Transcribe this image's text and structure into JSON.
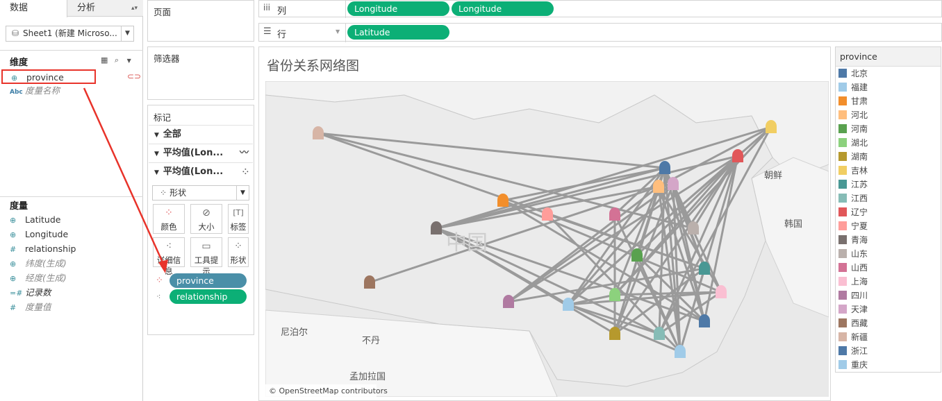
{
  "tabs": {
    "data": "数据",
    "analysis": "分析"
  },
  "datasource": {
    "name": "Sheet1 (新建 Microso..."
  },
  "dimensions": {
    "title": "维度",
    "items": [
      {
        "label": "province",
        "icon": "globe-icon"
      },
      {
        "label": "度量名称",
        "icon": "Abc"
      }
    ]
  },
  "measures": {
    "title": "度量",
    "items": [
      {
        "label": "Latitude",
        "icon": "globe-icon"
      },
      {
        "label": "Longitude",
        "icon": "globe-icon"
      },
      {
        "label": "relationship",
        "icon": "#"
      },
      {
        "label": "纬度(生成)",
        "icon": "globe-icon"
      },
      {
        "label": "经度(生成)",
        "icon": "globe-icon"
      },
      {
        "label": "记录数",
        "icon": "#"
      },
      {
        "label": "度量值",
        "icon": "#"
      }
    ]
  },
  "cards": {
    "pages": "页面",
    "filters": "筛选器",
    "marks": "标记"
  },
  "marks": {
    "all": "全部",
    "avg_lon1": "平均值(Lon...",
    "avg_lon2": "平均值(Lon...",
    "type": "形状",
    "buttons": {
      "color": "颜色",
      "size": "大小",
      "label": "标签",
      "detail": "详细信息",
      "tooltip": "工具提示",
      "shape": "形状"
    },
    "pills": [
      "province",
      "relationship"
    ]
  },
  "shelves": {
    "columns_label": "列",
    "rows_label": "行",
    "columns": [
      "Longitude",
      "Longitude"
    ],
    "rows": [
      "Latitude"
    ]
  },
  "viz": {
    "title": "省份关系网络图",
    "attribution": "© OpenStreetMap contributors",
    "map_labels": {
      "korea_north": "朝鲜",
      "korea_south": "韩国",
      "nepal": "尼泊尔",
      "bhutan": "不丹",
      "bangladesh": "孟加拉国",
      "china": "中国"
    }
  },
  "legend": {
    "title": "province",
    "items": [
      {
        "name": "北京",
        "color": "#4e79a7"
      },
      {
        "name": "福建",
        "color": "#a0cbe8"
      },
      {
        "name": "甘肃",
        "color": "#f28e2b"
      },
      {
        "name": "河北",
        "color": "#ffbe7d"
      },
      {
        "name": "河南",
        "color": "#59a14f"
      },
      {
        "name": "湖北",
        "color": "#8cd17d"
      },
      {
        "name": "湖南",
        "color": "#b6992d"
      },
      {
        "name": "吉林",
        "color": "#f1ce63"
      },
      {
        "name": "江苏",
        "color": "#499894"
      },
      {
        "name": "江西",
        "color": "#86bcb6"
      },
      {
        "name": "辽宁",
        "color": "#e15759"
      },
      {
        "name": "宁夏",
        "color": "#ff9d9a"
      },
      {
        "name": "青海",
        "color": "#79706e"
      },
      {
        "name": "山东",
        "color": "#bab0ac"
      },
      {
        "name": "山西",
        "color": "#d37295"
      },
      {
        "name": "上海",
        "color": "#fabfd2"
      },
      {
        "name": "四川",
        "color": "#b07aa1"
      },
      {
        "name": "天津",
        "color": "#d4a6c8"
      },
      {
        "name": "西藏",
        "color": "#9d7660"
      },
      {
        "name": "新疆",
        "color": "#d7b5a6"
      },
      {
        "name": "浙江",
        "color": "#4e79a7"
      },
      {
        "name": "重庆",
        "color": "#a0cbe8"
      }
    ]
  }
}
